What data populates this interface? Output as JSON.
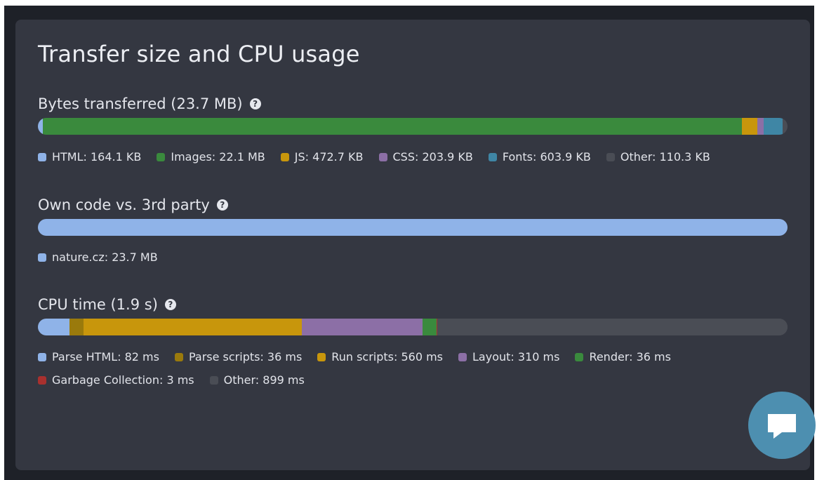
{
  "title": "Transfer size and CPU usage",
  "help_icon": "question-circle-icon",
  "chat_icon": "chat-bubble-icon",
  "sections": {
    "bytes": {
      "label": "Bytes transferred (23.7 MB)",
      "legend": [
        {
          "text": "HTML: 164.1 KB",
          "color": "#8fb3e8",
          "share": 0.0069
        },
        {
          "text": "Images: 22.1 MB",
          "color": "#3a8a3d",
          "share": 0.9325
        },
        {
          "text": "JS: 472.7 KB",
          "color": "#c8960c",
          "share": 0.0199
        },
        {
          "text": "CSS: 203.9 KB",
          "color": "#8c6fa6",
          "share": 0.0086
        },
        {
          "text": "Fonts: 603.9 KB",
          "color": "#3f86a5",
          "share": 0.0255
        },
        {
          "text": "Other: 110.3 KB",
          "color": "#4a4d55",
          "share": 0.0047
        }
      ]
    },
    "party": {
      "label": "Own code vs. 3rd party",
      "legend": [
        {
          "text": "nature.cz: 23.7 MB",
          "color": "#8fb3e8",
          "share": 1.0
        }
      ]
    },
    "cpu": {
      "label": "CPU time (1.9 s)",
      "legend": [
        {
          "text": "Parse HTML: 82 ms",
          "color": "#8fb3e8",
          "share": 0.0427
        },
        {
          "text": "Parse scripts: 36 ms",
          "color": "#9a7a0c",
          "share": 0.0187
        },
        {
          "text": "Run scripts: 560 ms",
          "color": "#c8960c",
          "share": 0.2915
        },
        {
          "text": "Layout: 310 ms",
          "color": "#8c6fa6",
          "share": 0.1614
        },
        {
          "text": "Render: 36 ms",
          "color": "#3a8a3d",
          "share": 0.0187
        },
        {
          "text": "Garbage Collection: 3 ms",
          "color": "#a8302e",
          "share": 0.0016
        },
        {
          "text": "Other: 899 ms",
          "color": "#4a4d55",
          "share": 0.468
        }
      ]
    }
  }
}
